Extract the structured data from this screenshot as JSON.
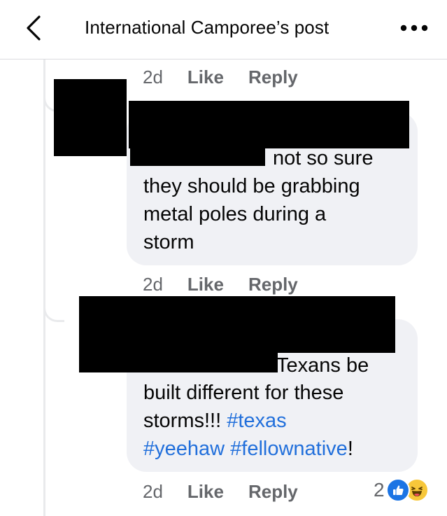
{
  "header": {
    "title": "International Camporee’s post"
  },
  "comments": [
    {
      "time": "2d",
      "like_label": "Like",
      "reply_label": "Reply"
    },
    {
      "text_lines": [
        "not so sure",
        "they should be grabbing",
        "metal poles during a",
        "storm"
      ],
      "time": "2d",
      "like_label": "Like",
      "reply_label": "Reply"
    },
    {
      "text_line1": "Texans be",
      "text_line2": "built different for these",
      "text_line3": "storms!!! ",
      "hashtag_texas": "#texas",
      "hashtag_yeehaw": "#yeehaw",
      "hashtag_fellownative": "#fellownative",
      "text_end": "!",
      "time": "2d",
      "like_label": "Like",
      "reply_label": "Reply",
      "reaction_count": "2"
    }
  ],
  "colors": {
    "link": "#216fdb",
    "meta": "#65676b",
    "bubble": "#f0f1f5",
    "like": "#1b74e4",
    "haha": "#f7c73a"
  },
  "icons": [
    "chevron-left-icon",
    "more-horizontal-icon",
    "like-reaction-icon",
    "haha-reaction-icon"
  ]
}
